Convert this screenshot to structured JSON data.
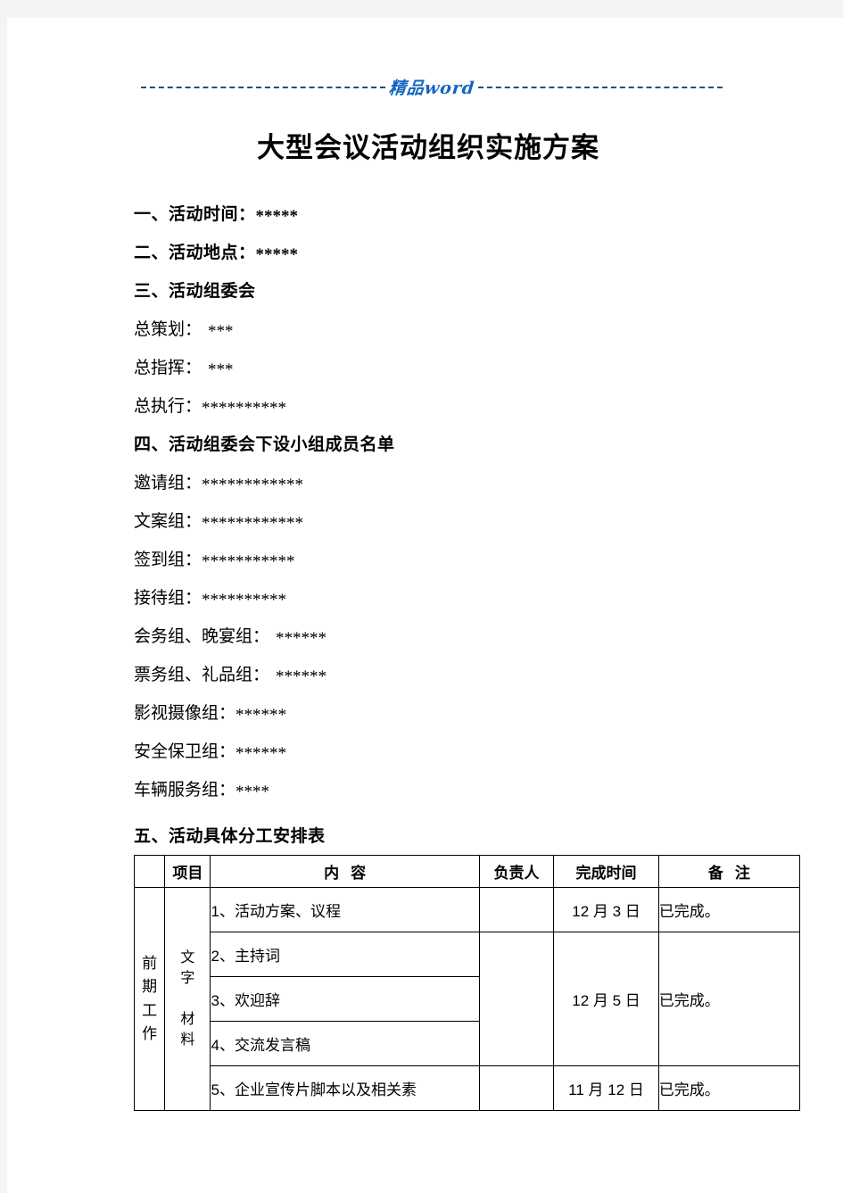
{
  "watermark": {
    "text": "精品word",
    "color": "#1565c0",
    "rule_color": "#2b4a7d"
  },
  "title": "大型会议活动组织实施方案",
  "sections": [
    {
      "label": "一、活动时间：",
      "value": "*****",
      "heading": true
    },
    {
      "label": "二、活动地点：",
      "value": "*****",
      "heading": true
    },
    {
      "label": "三、活动组委会",
      "value": "",
      "heading": true
    },
    {
      "label": "总策划：",
      "value": "***",
      "heading": false
    },
    {
      "label": "总指挥：",
      "value": "***",
      "heading": false
    },
    {
      "label": "总执行：",
      "value": "**********",
      "heading": false
    },
    {
      "label": "四、活动组委会下设小组成员名单",
      "value": "",
      "heading": true
    },
    {
      "label": "邀请组：",
      "value": "************",
      "heading": false
    },
    {
      "label": "文案组：",
      "value": "************",
      "heading": false
    },
    {
      "label": "签到组：",
      "value": "***********",
      "heading": false
    },
    {
      "label": "接待组：",
      "value": "**********",
      "heading": false
    },
    {
      "label": "会务组、晚宴组：",
      "value": "******",
      "heading": false
    },
    {
      "label": "票务组、礼品组：",
      "value": "******",
      "heading": false
    },
    {
      "label": "影视摄像组：",
      "value": "******",
      "heading": false
    },
    {
      "label": "安全保卫组：",
      "value": "******",
      "heading": false
    },
    {
      "label": "车辆服务组：",
      "value": "****",
      "heading": false
    }
  ],
  "table_heading": "五、活动具体分工安排表",
  "table": {
    "headers": {
      "blank": "",
      "item": "项目",
      "content_a": "内",
      "content_b": "容",
      "responsible": "负责人",
      "deadline": "完成时间",
      "note_a": "备",
      "note_b": "注"
    },
    "stage_label": [
      "前",
      "期",
      "工",
      "作"
    ],
    "item_label_top": [
      "文",
      "字"
    ],
    "item_label_bottom": [
      "材",
      "料"
    ],
    "rows": [
      {
        "content": "1、活动方案、议程",
        "responsible": "",
        "deadline": "12 月 3 日",
        "note": "已完成。"
      },
      {
        "content": "2、主持词",
        "responsible": "",
        "deadline": "12 月 5 日",
        "note": "已完成。"
      },
      {
        "content": "3、欢迎辞",
        "responsible": "",
        "deadline": "",
        "note": ""
      },
      {
        "content": "4、交流发言稿",
        "responsible": "",
        "deadline": "",
        "note": ""
      },
      {
        "content": "5、企业宣传片脚本以及相关素",
        "responsible": "",
        "deadline": "11 月 12 日",
        "note": "已完成。"
      }
    ]
  }
}
